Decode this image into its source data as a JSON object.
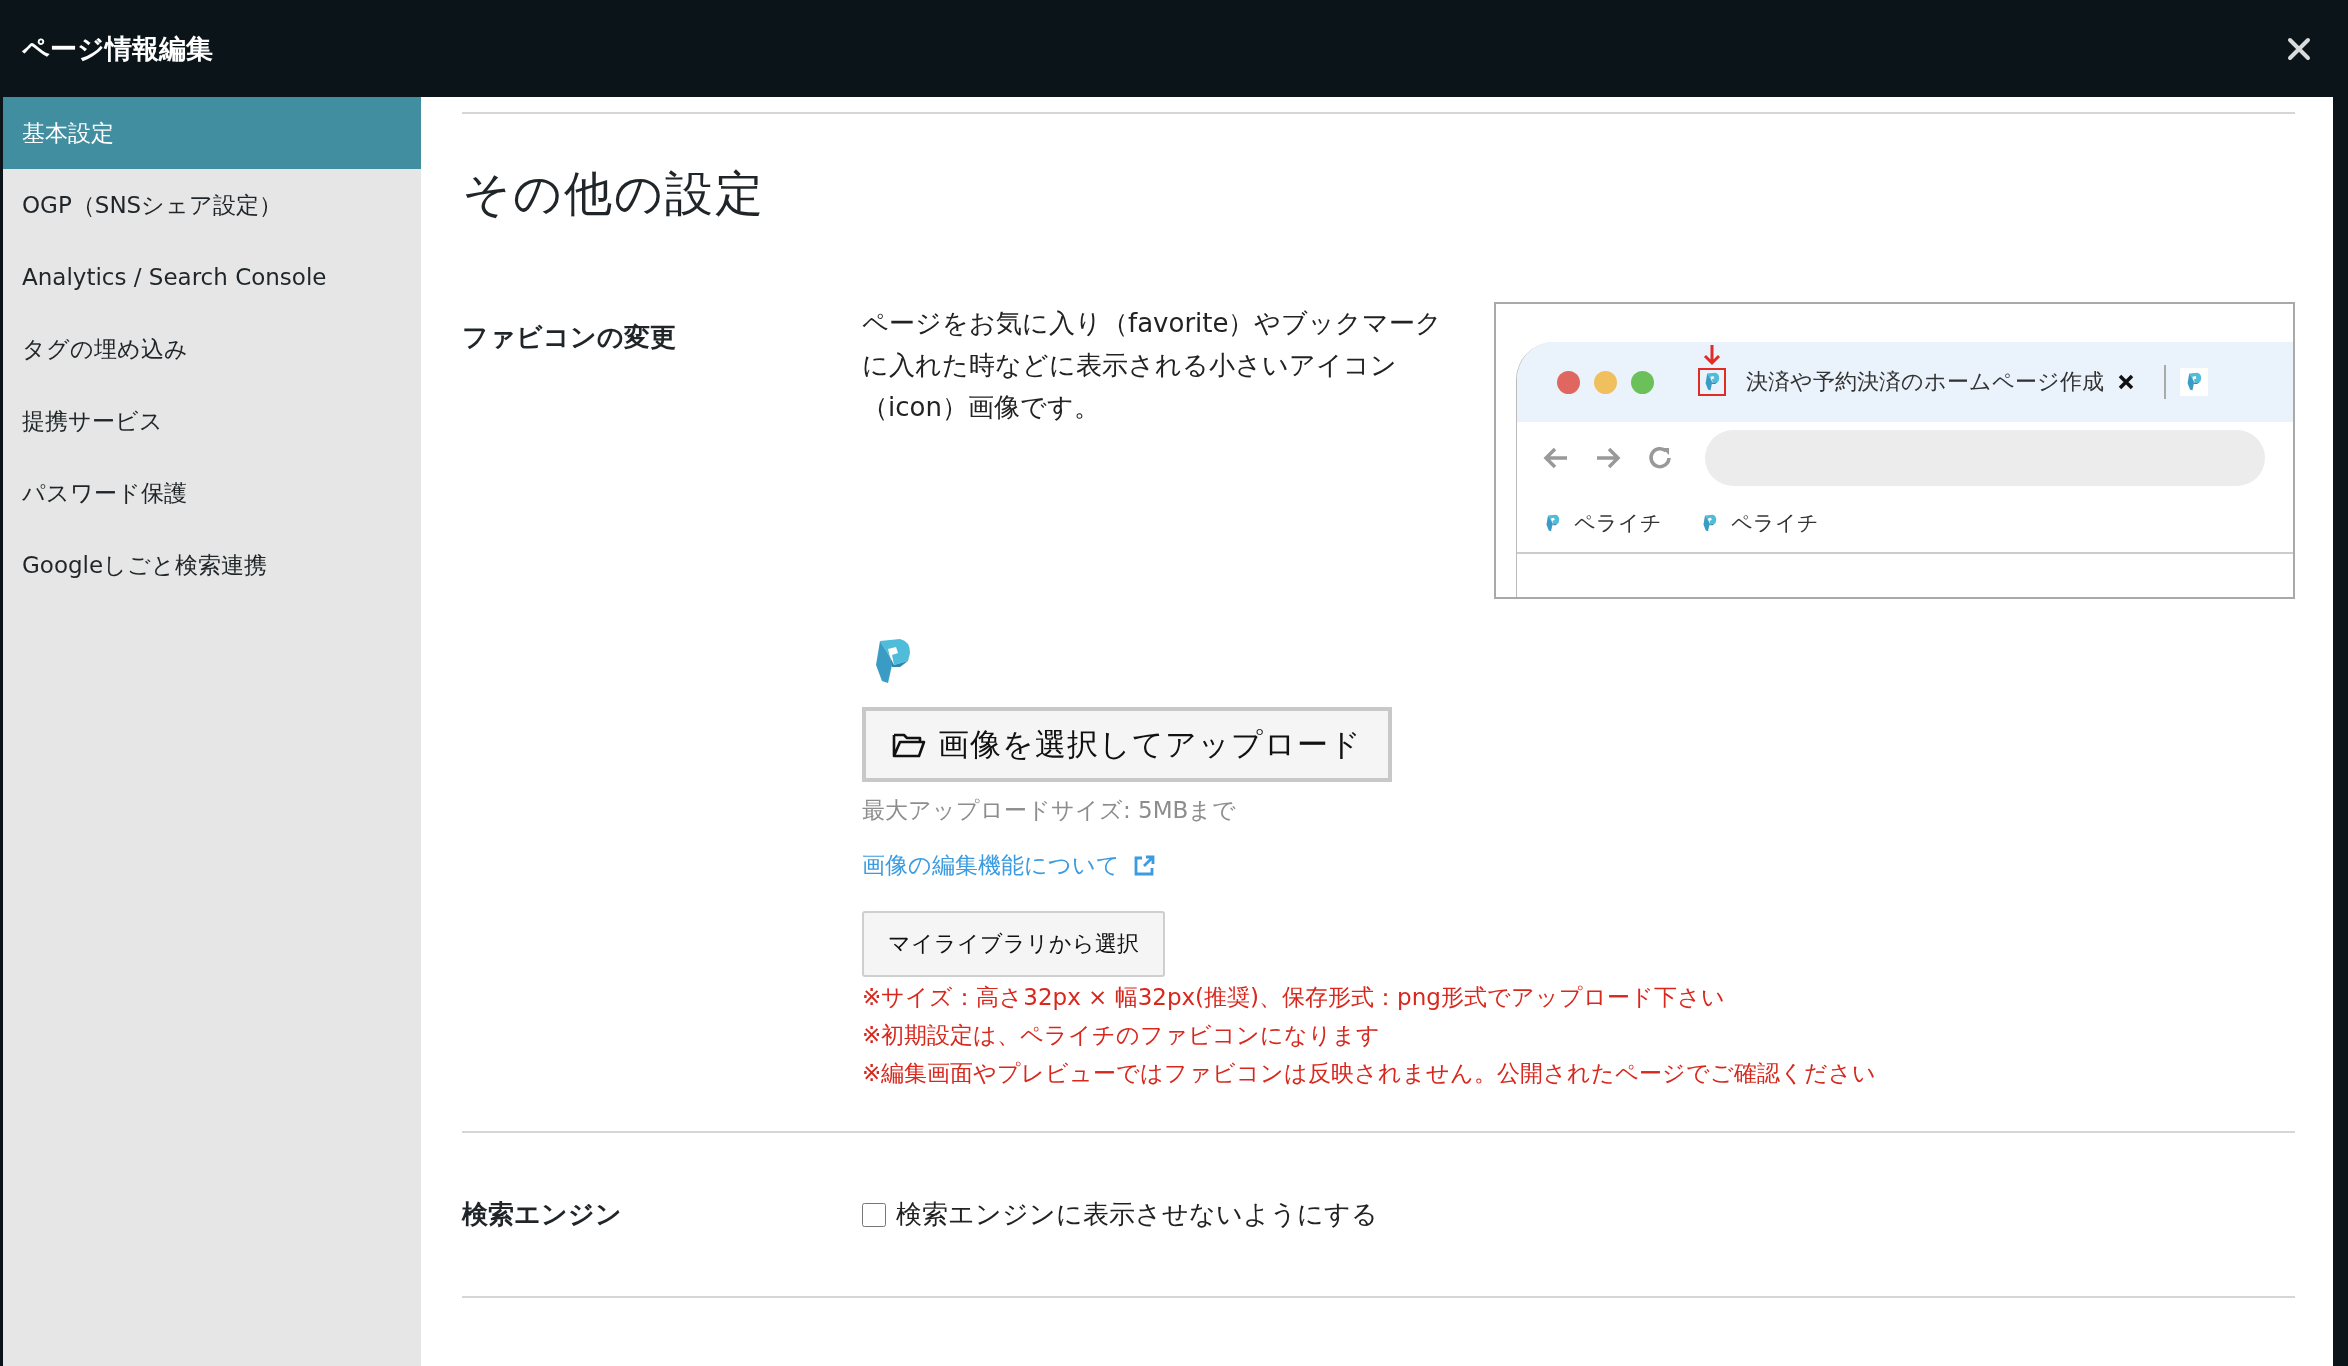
{
  "window": {
    "title": "ページ情報編集"
  },
  "sidebar": {
    "items": [
      {
        "label": "基本設定",
        "selected": true
      },
      {
        "label": "OGP（SNSシェア設定）",
        "selected": false
      },
      {
        "label": "Analytics / Search Console",
        "selected": false
      },
      {
        "label": "タグの埋め込み",
        "selected": false
      },
      {
        "label": "提携サービス",
        "selected": false
      },
      {
        "label": "パスワード保護",
        "selected": false
      },
      {
        "label": "Googleしごと検索連携",
        "selected": false
      }
    ]
  },
  "section": {
    "title": "その他の設定"
  },
  "favicon": {
    "label": "ファビコンの変更",
    "description": "ページをお気に入り（favorite）やブックマークに入れた時などに表示される小さいアイコン（icon）画像です。",
    "preview": {
      "tab_title": "決済や予約決済のホームページ作成",
      "bookmarks": [
        "ペライチ",
        "ペライチ"
      ]
    },
    "upload_button": "画像を選択してアップロード",
    "size_note": "最大アップロードサイズ: 5MBまで",
    "edit_link": "画像の編集機能について",
    "library_button": "マイライブラリから選択",
    "notes": [
      "※サイズ：高さ32px × 幅32px(推奨)、保存形式：png形式でアップロード下さい",
      "※初期設定は、ペライチのファビコンになります",
      "※編集画面やプレビューではファビコンは反映されません。公開されたページでご確認ください"
    ]
  },
  "search_engine": {
    "label": "検索エンジン",
    "checkbox_label": "検索エンジンに表示させないようにする",
    "checked": false
  }
}
